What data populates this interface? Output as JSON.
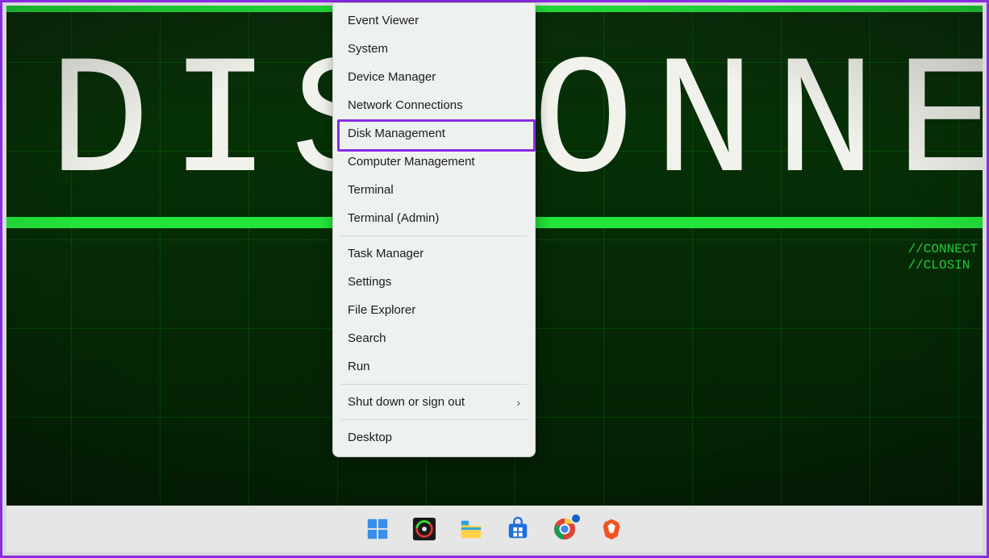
{
  "wallpaper": {
    "big_text": "DISCONNECTEI",
    "side_line1": "//CONNECT",
    "side_line2": "//CLOSIN"
  },
  "context_menu": {
    "items": [
      {
        "label": "Event Viewer",
        "has_submenu": false
      },
      {
        "label": "System",
        "has_submenu": false
      },
      {
        "label": "Device Manager",
        "has_submenu": false
      },
      {
        "label": "Network Connections",
        "has_submenu": false
      },
      {
        "label": "Disk Management",
        "has_submenu": false
      },
      {
        "label": "Computer Management",
        "has_submenu": false
      },
      {
        "label": "Terminal",
        "has_submenu": false
      },
      {
        "label": "Terminal (Admin)",
        "has_submenu": false
      },
      {
        "label": "Task Manager",
        "has_submenu": false
      },
      {
        "label": "Settings",
        "has_submenu": false
      },
      {
        "label": "File Explorer",
        "has_submenu": false
      },
      {
        "label": "Search",
        "has_submenu": false
      },
      {
        "label": "Run",
        "has_submenu": false
      },
      {
        "label": "Shut down or sign out",
        "has_submenu": true
      },
      {
        "label": "Desktop",
        "has_submenu": false
      }
    ],
    "separators_after": [
      7,
      12,
      13
    ],
    "highlighted_index": 4
  },
  "taskbar": {
    "items": [
      {
        "name": "start-button",
        "icon": "windows"
      },
      {
        "name": "app-1",
        "icon": "disc"
      },
      {
        "name": "file-explorer",
        "icon": "folder"
      },
      {
        "name": "microsoft-store",
        "icon": "store"
      },
      {
        "name": "google-chrome",
        "icon": "chrome"
      },
      {
        "name": "brave-browser",
        "icon": "brave"
      }
    ]
  },
  "colors": {
    "accent_purple": "#8a2be2",
    "green_bright": "#22e53a"
  }
}
